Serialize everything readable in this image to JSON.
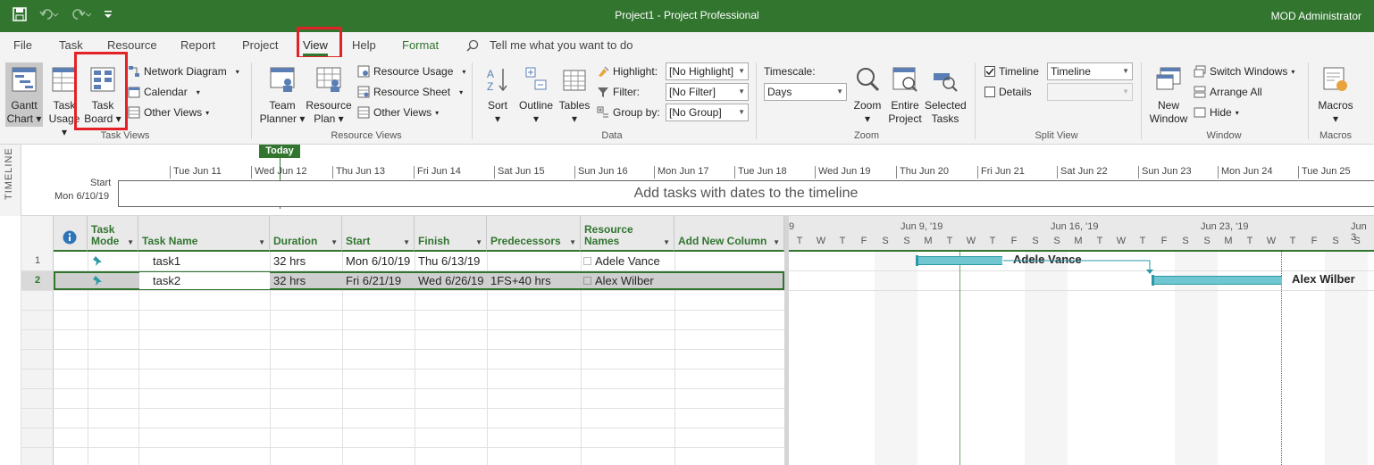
{
  "app": {
    "title": "Project1  -  Project Professional",
    "user": "MOD Administrator",
    "brand_color": "#31752f",
    "highlight_color": "#e32227"
  },
  "tabs": {
    "file": "File",
    "task": "Task",
    "resource": "Resource",
    "report": "Report",
    "project": "Project",
    "view": "View",
    "help": "Help",
    "format": "Format",
    "tell_me": "Tell me what you want to do",
    "active": "View"
  },
  "ribbon": {
    "task_views": {
      "label": "Task Views",
      "gantt_chart": [
        "Gantt",
        "Chart"
      ],
      "task_usage": [
        "Task",
        "Usage"
      ],
      "task_board": [
        "Task",
        "Board"
      ],
      "network_diagram": "Network Diagram",
      "calendar": "Calendar",
      "other_views": "Other Views"
    },
    "resource_views": {
      "label": "Resource Views",
      "team_planner": [
        "Team",
        "Planner"
      ],
      "resource_plan": [
        "Resource",
        "Plan"
      ],
      "resource_usage": "Resource Usage",
      "resource_sheet": "Resource Sheet",
      "other_views": "Other Views"
    },
    "data": {
      "label": "Data",
      "sort": "Sort",
      "outline": "Outline",
      "tables": "Tables",
      "highlight_label": "Highlight:",
      "highlight_value": "[No Highlight]",
      "filter_label": "Filter:",
      "filter_value": "[No Filter]",
      "group_label": "Group by:",
      "group_value": "[No Group]"
    },
    "zoom": {
      "label": "Zoom",
      "timescale_label": "Timescale:",
      "timescale_value": "Days",
      "zoom": "Zoom",
      "entire_project": [
        "Entire",
        "Project"
      ],
      "selected_tasks": [
        "Selected",
        "Tasks"
      ]
    },
    "split_view": {
      "label": "Split View",
      "timeline_check": "Timeline",
      "timeline_checked": true,
      "timeline_value": "Timeline",
      "details_check": "Details",
      "details_checked": false
    },
    "window": {
      "label": "Window",
      "new_window": [
        "New",
        "Window"
      ],
      "switch_windows": "Switch Windows",
      "arrange_all": "Arrange All",
      "hide": "Hide"
    },
    "macros": {
      "label": "Macros",
      "macros": "Macros"
    }
  },
  "timeline": {
    "side_label": "TIMELINE",
    "today": "Today",
    "start_label": "Start",
    "start_date": "Mon 6/10/19",
    "dates": [
      "Tue Jun 11",
      "Wed Jun 12",
      "Thu Jun 13",
      "Fri Jun 14",
      "Sat Jun 15",
      "Sun Jun 16",
      "Mon Jun 17",
      "Tue Jun 18",
      "Wed Jun 19",
      "Thu Jun 20",
      "Fri Jun 21",
      "Sat Jun 22",
      "Sun Jun 23",
      "Mon Jun 24",
      "Tue Jun 25"
    ],
    "placeholder": "Add tasks with dates to the timeline"
  },
  "grid": {
    "columns": {
      "info": "i",
      "task_mode": [
        "Task",
        "Mode"
      ],
      "task_name": "Task Name",
      "duration": "Duration",
      "start": "Start",
      "finish": "Finish",
      "predecessors": "Predecessors",
      "resource_names": [
        "Resource",
        "Names"
      ],
      "add_new": "Add New Column"
    },
    "rows": [
      {
        "id": "1",
        "name": "task1",
        "duration": "32 hrs",
        "start": "Mon 6/10/19",
        "finish": "Thu 6/13/19",
        "predecessors": "",
        "resource": "Adele Vance"
      },
      {
        "id": "2",
        "name": "task2",
        "duration": "32 hrs",
        "start": "Fri 6/21/19",
        "finish": "Wed 6/26/19",
        "predecessors": "1FS+40 hrs",
        "resource": "Alex Wilber"
      }
    ]
  },
  "gantt": {
    "weeks": [
      "9",
      "Jun 9, '19",
      "Jun 16, '19",
      "Jun 23, '19",
      "Jun 3"
    ],
    "days": [
      "T",
      "W",
      "T",
      "F",
      "S",
      "S",
      "M",
      "T",
      "W",
      "T",
      "F",
      "S",
      "S",
      "M",
      "T",
      "W",
      "T",
      "F",
      "S",
      "S",
      "M",
      "T",
      "W",
      "T",
      "F",
      "S",
      "S"
    ],
    "bars": [
      {
        "label": "Adele Vance"
      },
      {
        "label": "Alex Wilber"
      }
    ]
  }
}
